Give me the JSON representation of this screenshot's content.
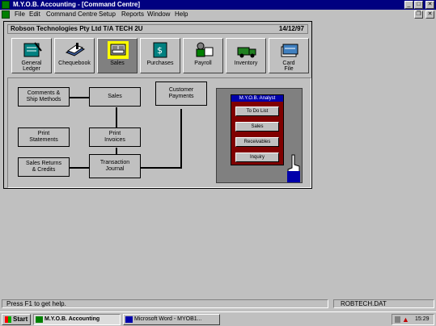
{
  "window": {
    "title": "M.Y.O.B. Accounting - [Command Centre]",
    "min_glyph": "_",
    "max_glyph": "□",
    "close_glyph": "✕",
    "restore_glyph": "❐"
  },
  "menu": [
    "File",
    "Edit",
    "Command Centre",
    "Setup",
    "Reports",
    "Window",
    "Help"
  ],
  "header": {
    "company": "Robson Technologies Pty Ltd T/A TECH 2U",
    "date": "14/12/97"
  },
  "centres": [
    {
      "label": "General\nLedger",
      "icon": "ledger-icon",
      "color": "#008080"
    },
    {
      "label": "Chequebook",
      "icon": "chequebook-icon",
      "color": "#4060a0"
    },
    {
      "label": "Sales",
      "icon": "sales-icon",
      "color": "#ffff00",
      "active": true
    },
    {
      "label": "Purchases",
      "icon": "purchases-icon",
      "color": "#008080"
    },
    {
      "label": "Payroll",
      "icon": "payroll-icon",
      "color": "#008000"
    },
    {
      "label": "Inventory",
      "icon": "inventory-icon",
      "color": "#208020"
    },
    {
      "label": "Card\nFile",
      "icon": "card-file-icon",
      "color": "#4080c0"
    }
  ],
  "flow": {
    "comments": "Comments &\nShip Methods",
    "sales": "Sales",
    "customer_payments": "Customer\nPayments",
    "print_statements": "Print\nStatements",
    "print_invoices": "Print\nInvoices",
    "sales_returns": "Sales Returns\n& Credits",
    "transaction_journal": "Transaction\nJournal"
  },
  "analyst": {
    "title": "M.Y.O.B. Analyst",
    "buttons": [
      "To Do List",
      "Sales",
      "Receivables",
      "Inquiry"
    ]
  },
  "status": {
    "help": "Press F1 to get help.",
    "file": "ROBTECH.DAT"
  },
  "taskbar": {
    "start": "Start",
    "tasks": [
      "M.Y.O.B. Accounting",
      "Microsoft Word - MYOB1..."
    ],
    "time": "15:29"
  },
  "colors": {
    "desktop": "#c0c0c0",
    "titlebar": "#000080",
    "analyst_bg": "#800000",
    "analyst_title": "#0000aa"
  }
}
